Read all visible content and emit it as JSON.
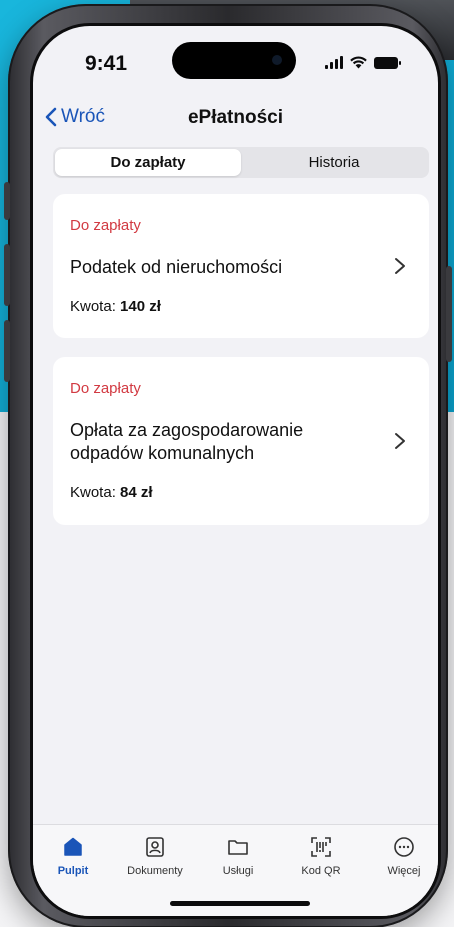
{
  "status_bar": {
    "time": "9:41"
  },
  "nav": {
    "back_label": "Wróć",
    "title": "ePłatności"
  },
  "segmented": {
    "tabs": [
      {
        "label": "Do zapłaty"
      },
      {
        "label": "Historia"
      }
    ]
  },
  "payments": [
    {
      "status": "Do zapłaty",
      "title": "Podatek od nieruchomości",
      "amount_label": "Kwota:",
      "amount": "140 zł"
    },
    {
      "status": "Do zapłaty",
      "title": "Opłata za zagospodarowanie odpadów komunalnych",
      "amount_label": "Kwota:",
      "amount": "84 zł"
    }
  ],
  "tabbar": {
    "items": [
      {
        "label": "Pulpit",
        "icon": "home-icon"
      },
      {
        "label": "Dokumenty",
        "icon": "document-icon"
      },
      {
        "label": "Usługi",
        "icon": "folder-icon"
      },
      {
        "label": "Kod QR",
        "icon": "qr-scan-icon"
      },
      {
        "label": "Więcej",
        "icon": "more-icon"
      }
    ]
  },
  "colors": {
    "accent": "#1a55b8",
    "status_red": "#d23a42",
    "background_blue": "#19b6dc"
  }
}
